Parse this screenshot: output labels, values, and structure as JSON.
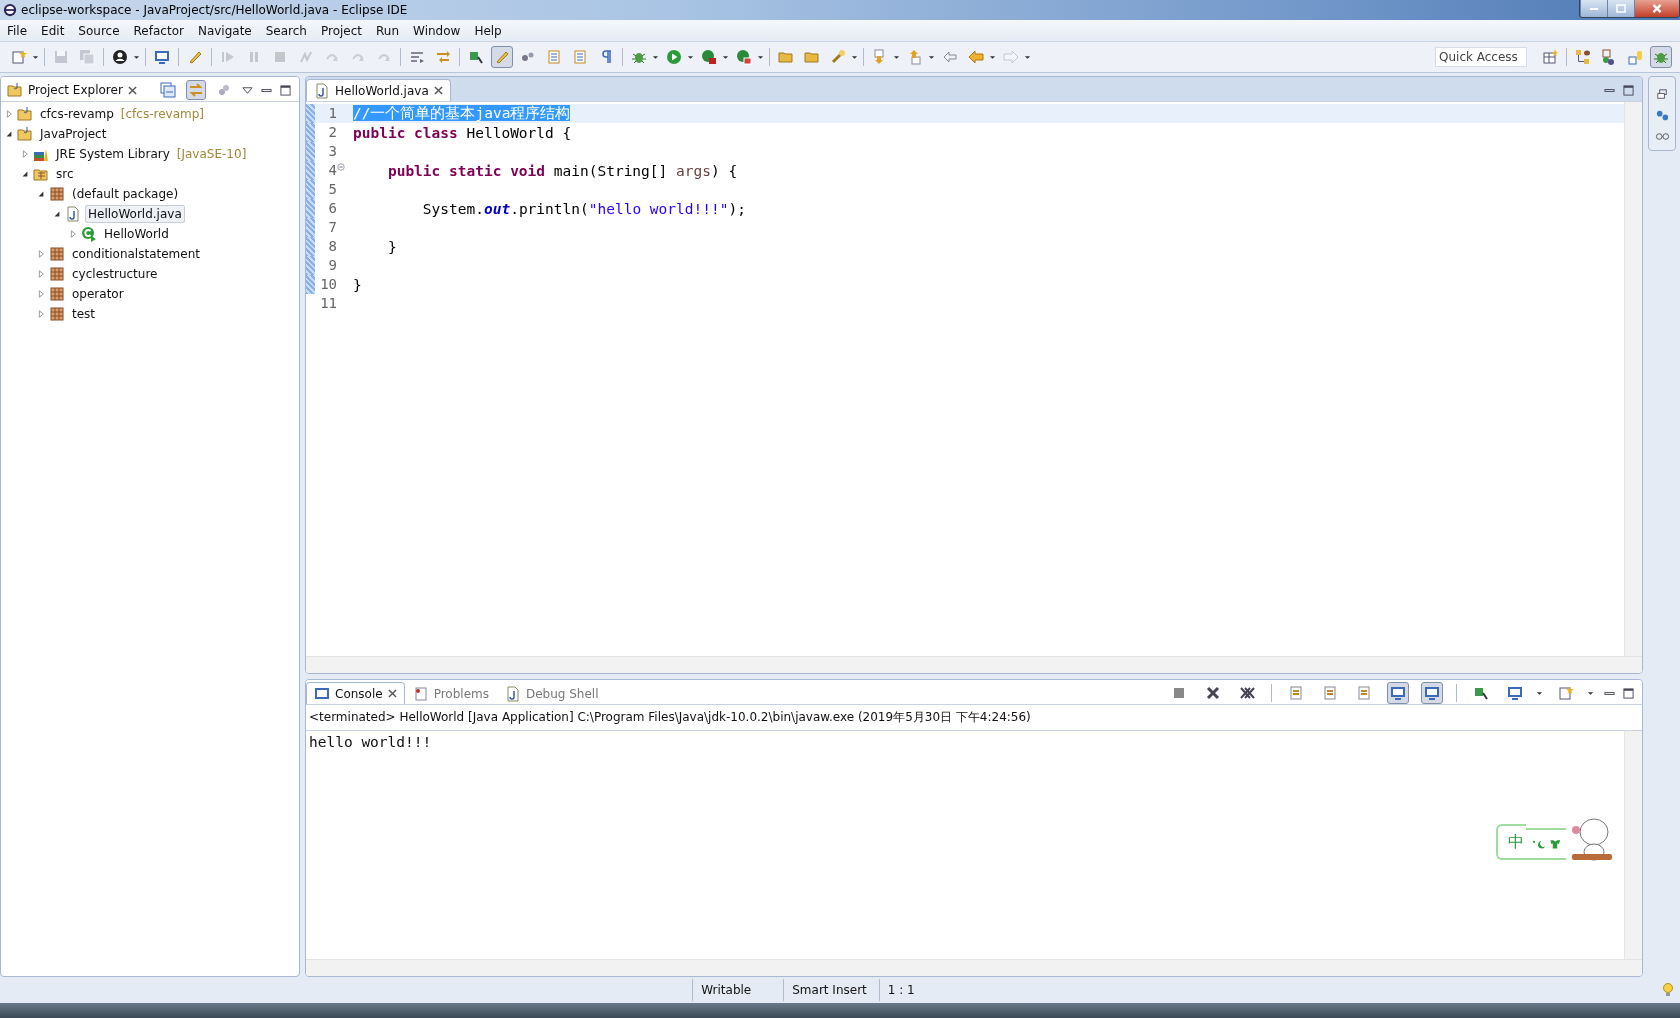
{
  "window": {
    "title": "eclipse-workspace - JavaProject/src/HelloWorld.java - Eclipse IDE"
  },
  "menu": [
    "File",
    "Edit",
    "Source",
    "Refactor",
    "Navigate",
    "Search",
    "Project",
    "Run",
    "Window",
    "Help"
  ],
  "toolbar": [
    {
      "kind": "new",
      "disabled": false,
      "on": false
    },
    {
      "kind": "caret"
    },
    {
      "kind": "sep"
    },
    {
      "kind": "save",
      "disabled": true,
      "on": false
    },
    {
      "kind": "saveall",
      "disabled": true,
      "on": false
    },
    {
      "kind": "sep"
    },
    {
      "kind": "person",
      "disabled": false,
      "on": false
    },
    {
      "kind": "caret"
    },
    {
      "kind": "sep"
    },
    {
      "kind": "monitor",
      "disabled": false,
      "on": false
    },
    {
      "kind": "sep"
    },
    {
      "kind": "pen",
      "disabled": false,
      "on": false
    },
    {
      "kind": "sep"
    },
    {
      "kind": "play",
      "disabled": true,
      "on": false
    },
    {
      "kind": "pause",
      "disabled": true,
      "on": false
    },
    {
      "kind": "stop",
      "disabled": true,
      "on": false
    },
    {
      "kind": "link",
      "disabled": true,
      "on": false
    },
    {
      "kind": "step",
      "disabled": true,
      "on": false
    },
    {
      "kind": "step",
      "disabled": true,
      "on": false
    },
    {
      "kind": "step",
      "disabled": true,
      "on": false
    },
    {
      "kind": "sep"
    },
    {
      "kind": "wrap",
      "disabled": false,
      "on": false
    },
    {
      "kind": "filter",
      "disabled": false,
      "on": false
    },
    {
      "kind": "sep"
    },
    {
      "kind": "pin",
      "disabled": false,
      "on": false
    },
    {
      "kind": "pen",
      "disabled": false,
      "on": true
    },
    {
      "kind": "shapes",
      "disabled": false,
      "on": false
    },
    {
      "kind": "table",
      "disabled": false,
      "on": false
    },
    {
      "kind": "table",
      "disabled": false,
      "on": false
    },
    {
      "kind": "para",
      "disabled": false,
      "on": false
    },
    {
      "kind": "sep"
    },
    {
      "kind": "bug",
      "disabled": false,
      "on": false
    },
    {
      "kind": "caret"
    },
    {
      "kind": "run",
      "disabled": false,
      "on": false
    },
    {
      "kind": "caret"
    },
    {
      "kind": "coverage",
      "disabled": false,
      "on": false
    },
    {
      "kind": "caret"
    },
    {
      "kind": "external",
      "disabled": false,
      "on": false
    },
    {
      "kind": "caret"
    },
    {
      "kind": "sep"
    },
    {
      "kind": "folder",
      "disabled": false,
      "on": false
    },
    {
      "kind": "folder",
      "disabled": false,
      "on": false
    },
    {
      "kind": "wand",
      "disabled": false,
      "on": false
    },
    {
      "kind": "caret"
    },
    {
      "kind": "sep"
    },
    {
      "kind": "down",
      "disabled": false,
      "on": false
    },
    {
      "kind": "caret"
    },
    {
      "kind": "up",
      "disabled": false,
      "on": false
    },
    {
      "kind": "caret"
    },
    {
      "kind": "back",
      "disabled": false,
      "on": false
    },
    {
      "kind": "left",
      "disabled": false,
      "on": false
    },
    {
      "kind": "caret"
    },
    {
      "kind": "right",
      "disabled": true,
      "on": false
    },
    {
      "kind": "caret"
    }
  ],
  "quick_access": {
    "placeholder": "Quick Access"
  },
  "perspectives": [
    {
      "kind": "open",
      "selected": false
    },
    {
      "kind": "sep"
    },
    {
      "kind": "hierarchy",
      "selected": false
    },
    {
      "kind": "java",
      "selected": false
    },
    {
      "kind": "db",
      "selected": false
    },
    {
      "kind": "bug",
      "selected": true
    }
  ],
  "project_explorer": {
    "title": "Project Explorer",
    "tree": [
      {
        "label": "cfcs-revamp",
        "decoration": "[cfcs-revamp]",
        "kind": "project",
        "expanded": false,
        "selected": false
      },
      {
        "label": "JavaProject",
        "kind": "project",
        "expanded": true,
        "selected": false,
        "children": [
          {
            "label": "JRE System Library",
            "decoration": "[JavaSE-10]",
            "kind": "library",
            "expanded": false,
            "selected": false
          },
          {
            "label": "src",
            "kind": "srcfolder",
            "expanded": true,
            "selected": false,
            "children": [
              {
                "label": "(default package)",
                "kind": "package",
                "expanded": true,
                "selected": false,
                "children": [
                  {
                    "label": "HelloWorld.java",
                    "kind": "javafile",
                    "expanded": true,
                    "selected": true,
                    "children": [
                      {
                        "label": "HelloWorld",
                        "kind": "class",
                        "expanded": false,
                        "selected": false
                      }
                    ]
                  }
                ]
              },
              {
                "label": "conditionalstatement",
                "kind": "package",
                "expanded": false,
                "selected": false
              },
              {
                "label": "cyclestructure",
                "kind": "package",
                "expanded": false,
                "selected": false
              },
              {
                "label": "operator",
                "kind": "package",
                "expanded": false,
                "selected": false
              },
              {
                "label": "test",
                "kind": "package",
                "expanded": false,
                "selected": false
              }
            ]
          }
        ]
      }
    ]
  },
  "editor": {
    "tabs": [
      {
        "label": "HelloWorld.java",
        "kind": "javafile",
        "selected": true
      }
    ],
    "lines": [
      {
        "number": "1",
        "current": true,
        "changed": true,
        "fold_marker": false,
        "tokens": [
          {
            "kind": "comment-selected",
            "text": "//一个简单的基本java程序结构"
          }
        ]
      },
      {
        "number": "2",
        "current": false,
        "changed": true,
        "fold_marker": false,
        "tokens": [
          {
            "kind": "keyword",
            "text": "public class"
          },
          {
            "kind": "plain",
            "text": " HelloWorld {"
          }
        ]
      },
      {
        "number": "3",
        "current": false,
        "changed": true,
        "fold_marker": false
      },
      {
        "number": "4",
        "current": false,
        "changed": true,
        "fold_marker": true,
        "tokens": [
          {
            "kind": "keyword",
            "text": "    public static void"
          },
          {
            "kind": "plain",
            "text": " main(String[] "
          },
          {
            "kind": "param",
            "text": "args"
          },
          {
            "kind": "plain",
            "text": ") {"
          }
        ]
      },
      {
        "number": "5",
        "current": false,
        "changed": true,
        "fold_marker": false
      },
      {
        "number": "6",
        "current": false,
        "changed": true,
        "fold_marker": false,
        "tokens": [
          {
            "kind": "plain",
            "text": "        System."
          },
          {
            "kind": "field",
            "text": "out"
          },
          {
            "kind": "plain",
            "text": ".println("
          },
          {
            "kind": "string",
            "text": "\"hello world!!!\""
          },
          {
            "kind": "plain",
            "text": ");"
          }
        ]
      },
      {
        "number": "7",
        "current": false,
        "changed": true,
        "fold_marker": false
      },
      {
        "number": "8",
        "current": false,
        "changed": true,
        "fold_marker": false,
        "tokens": [
          {
            "kind": "plain",
            "text": "    }"
          }
        ]
      },
      {
        "number": "9",
        "current": false,
        "changed": true,
        "fold_marker": false
      },
      {
        "number": "10",
        "current": false,
        "changed": true,
        "fold_marker": false,
        "tokens": [
          {
            "kind": "plain",
            "text": "}"
          }
        ]
      },
      {
        "number": "11",
        "current": false,
        "changed": false,
        "fold_marker": false
      }
    ]
  },
  "console": {
    "tabs": [
      {
        "label": "Console",
        "kind": "console",
        "selected": true
      },
      {
        "label": "Problems",
        "kind": "problems",
        "selected": false
      },
      {
        "label": "Debug Shell",
        "kind": "javafile",
        "selected": false
      }
    ],
    "toolbar": [
      {
        "kind": "stop",
        "on": false
      },
      {
        "kind": "remove",
        "on": false
      },
      {
        "kind": "removeall",
        "on": false
      },
      {
        "kind": "sep"
      },
      {
        "kind": "doc",
        "on": false
      },
      {
        "kind": "doc",
        "on": false
      },
      {
        "kind": "doc",
        "on": false
      },
      {
        "kind": "monitor",
        "on": true
      },
      {
        "kind": "monitor",
        "on": true
      },
      {
        "kind": "sep"
      },
      {
        "kind": "pin",
        "on": false
      },
      {
        "kind": "monitor",
        "on": false
      },
      {
        "kind": "caret"
      },
      {
        "kind": "new",
        "on": false
      },
      {
        "kind": "caret"
      }
    ],
    "description": "<terminated> HelloWorld [Java Application] C:\\Program Files\\Java\\jdk-10.0.2\\bin\\javaw.exe (2019年5月30日 下午4:24:56)",
    "output": [
      "hello world!!!"
    ]
  },
  "ime": {
    "label": "中"
  },
  "status_bar": [
    "Writable",
    "Smart Insert",
    "1 : 1"
  ]
}
